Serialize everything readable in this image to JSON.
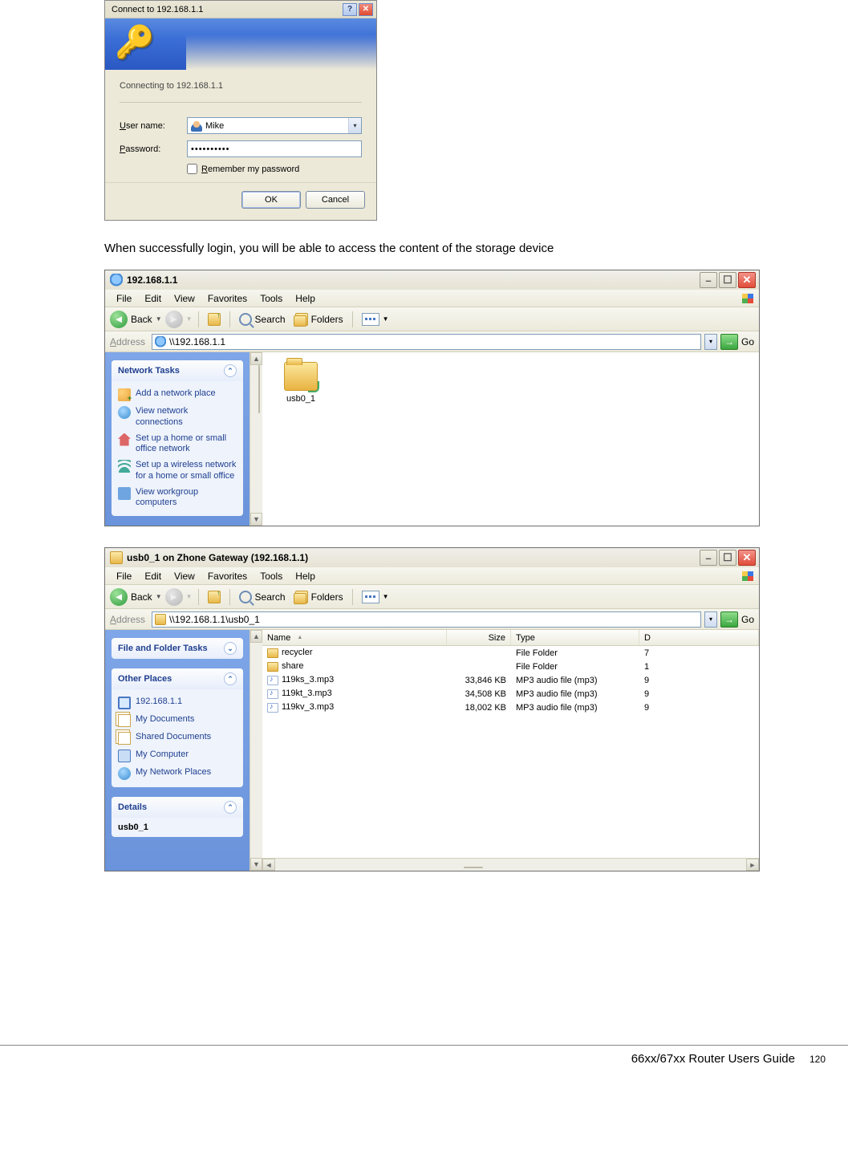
{
  "dialog": {
    "title": "Connect to 192.168.1.1",
    "connecting": "Connecting to 192.168.1.1",
    "user_label_pre": "U",
    "user_label_post": "ser name:",
    "pass_label_pre": "P",
    "pass_label_post": "assword:",
    "user_value": "Mike",
    "pass_value": "••••••••••",
    "remember_pre": "R",
    "remember_post": "emember my password",
    "ok": "OK",
    "cancel": "Cancel"
  },
  "body_text": "When successfully login, you will be able to access the content of the storage device",
  "explorer1": {
    "title": "192.168.1.1",
    "menus": [
      "File",
      "Edit",
      "View",
      "Favorites",
      "Tools",
      "Help"
    ],
    "tb_back": "Back",
    "tb_search": "Search",
    "tb_folders": "Folders",
    "addr_label": "Address",
    "addr_value": "\\\\192.168.1.1",
    "go": "Go",
    "tasks_title": "Network Tasks",
    "tasks": [
      "Add a network place",
      "View network connections",
      "Set up a home or small office network",
      "Set up a wireless network for a home or small office",
      "View workgroup computers"
    ],
    "item_label": "usb0_1"
  },
  "explorer2": {
    "title": "usb0_1 on Zhone Gateway (192.168.1.1)",
    "menus": [
      "File",
      "Edit",
      "View",
      "Favorites",
      "Tools",
      "Help"
    ],
    "tb_back": "Back",
    "tb_search": "Search",
    "tb_folders": "Folders",
    "addr_label": "Address",
    "addr_value": "\\\\192.168.1.1\\usb0_1",
    "go": "Go",
    "tasks_title": "File and Folder Tasks",
    "other_title": "Other Places",
    "other_places": [
      "192.168.1.1",
      "My Documents",
      "Shared Documents",
      "My Computer",
      "My Network Places"
    ],
    "details_title": "Details",
    "details_name": "usb0_1",
    "columns": {
      "name": "Name",
      "size": "Size",
      "type": "Type",
      "d": "D"
    },
    "rows": [
      {
        "icon": "fold",
        "name": "recycler",
        "size": "",
        "type": "File Folder",
        "d": "7"
      },
      {
        "icon": "fold",
        "name": "share",
        "size": "",
        "type": "File Folder",
        "d": "1"
      },
      {
        "icon": "mp3",
        "name": "119ks_3.mp3",
        "size": "33,846 KB",
        "type": "MP3 audio file (mp3)",
        "d": "9"
      },
      {
        "icon": "mp3",
        "name": "119kt_3.mp3",
        "size": "34,508 KB",
        "type": "MP3 audio file (mp3)",
        "d": "9"
      },
      {
        "icon": "mp3",
        "name": "119kv_3.mp3",
        "size": "18,002 KB",
        "type": "MP3 audio file (mp3)",
        "d": "9"
      }
    ]
  },
  "footer": {
    "guide": "66xx/67xx Router Users Guide",
    "page": "120"
  }
}
